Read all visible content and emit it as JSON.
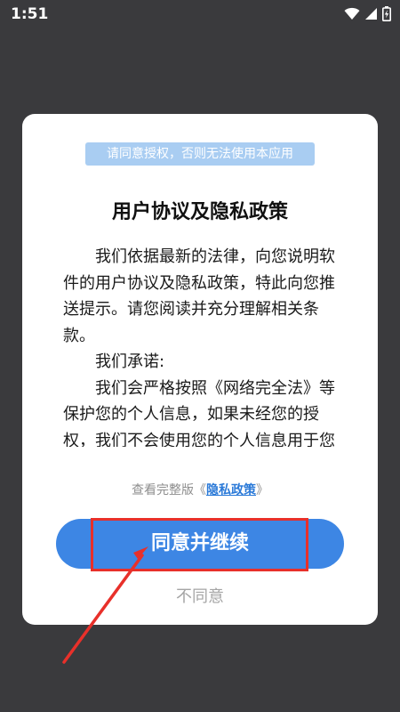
{
  "status_bar": {
    "time": "1:51",
    "icons": [
      "wifi-icon",
      "signal-icon",
      "battery-charging-icon"
    ]
  },
  "dialog": {
    "notice": "请同意授权，否则无法使用本应用",
    "title": "用户协议及隐私政策",
    "paragraphs": [
      "我们依据最新的法律，向您说明软件的用户协议及隐私政策，特此向您推送提示。请您阅读并充分理解相关条款。",
      "我们承诺:",
      "我们会严格按照《网络完全法》等保护您的个人信息，如果未经您的授权，我们不会使用您的个人信息用于您"
    ],
    "policy_prefix": "查看完整版《",
    "policy_link": "隐私政策",
    "policy_suffix": "》",
    "agree_label": "同意并继续",
    "disagree_label": "不同意"
  },
  "colors": {
    "background": "#3a3a3d",
    "dialog": "#ffffff",
    "notice_bg": "#a9cdf2",
    "primary": "#3d86e4",
    "link": "#2b7ad8",
    "annotation": "#e8302a"
  }
}
